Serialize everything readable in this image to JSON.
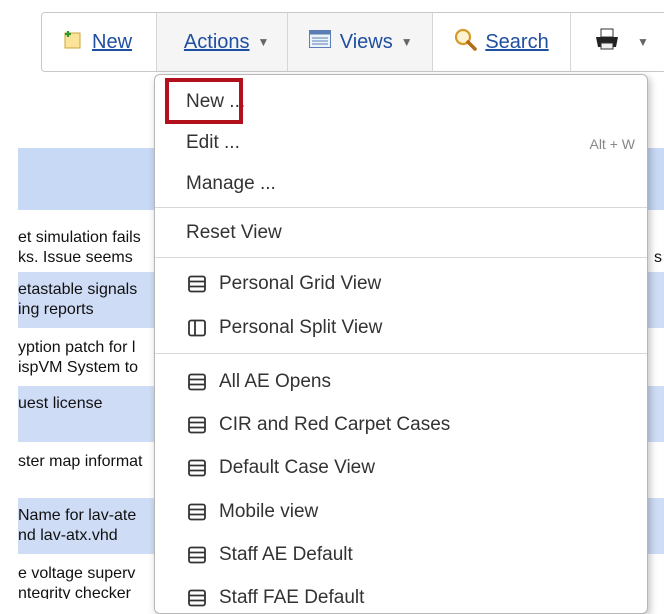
{
  "toolbar": {
    "new_label": "New",
    "actions_label": "Actions",
    "views_label": "Views",
    "search_label": "Search",
    "print_icon": "printer-icon"
  },
  "background_rows": [
    {
      "line1": "et simulation fails",
      "line2": "ks. Issue seems",
      "tail": "s",
      "alt": false
    },
    {
      "line1": "etastable signals",
      "line2": "ing reports",
      "alt": true
    },
    {
      "line1": "yption patch for l",
      "line2": "ispVM System to",
      "alt": false
    },
    {
      "line1": "uest license",
      "line2": "",
      "alt": true
    },
    {
      "line1": "ster map informat",
      "line2": "",
      "alt": false
    },
    {
      "line1": "Name for lav-ate",
      "line2": "nd lav-atx.vhd",
      "alt": true
    },
    {
      "line1": "e voltage superv",
      "line2": "ntegrity checker",
      "alt": false
    }
  ],
  "menu": {
    "new": "New ...",
    "edit": "Edit ...",
    "edit_shortcut": "Alt + W",
    "manage": "Manage ...",
    "reset_view": "Reset View",
    "personal_views": [
      {
        "label": "Personal Grid View",
        "icon": "grid-view-icon"
      },
      {
        "label": "Personal Split View",
        "icon": "split-view-icon"
      }
    ],
    "shared_views": [
      {
        "label": "All AE Opens",
        "icon": "grid-view-icon"
      },
      {
        "label": "CIR and Red Carpet Cases",
        "icon": "grid-view-icon"
      },
      {
        "label": "Default Case View",
        "icon": "grid-view-icon"
      },
      {
        "label": "Mobile view",
        "icon": "grid-view-icon"
      },
      {
        "label": "Staff AE Default",
        "icon": "grid-view-icon"
      },
      {
        "label": "Staff FAE Default",
        "icon": "grid-view-icon"
      }
    ]
  },
  "colors": {
    "link": "#1f4fa0",
    "row_highlight": "#cfdcf6",
    "annotation_box": "#b3101d"
  }
}
